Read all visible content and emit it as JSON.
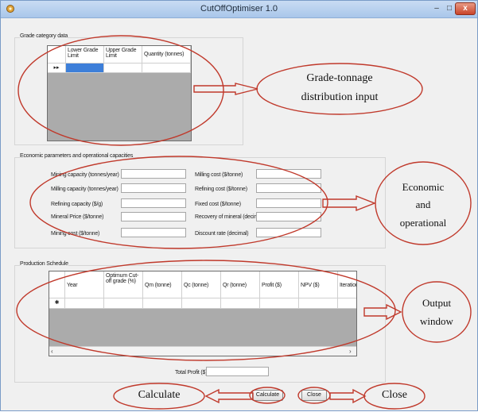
{
  "window": {
    "title": "CutOffOptimiser 1.0",
    "minimize": "–",
    "maximize": "□",
    "close": "x"
  },
  "grade_section": {
    "label": "Grade category data",
    "columns": [
      "Lower Grade Limit",
      "Upper Grade Limit",
      "Quantity (tonnes)"
    ],
    "row_marker": "▸▸"
  },
  "economic_section": {
    "label": "Economic parameters and operational capacities",
    "left_fields": [
      {
        "label": "Mining capacity (tonnes/year)",
        "value": ""
      },
      {
        "label": "Milling capacity (tonnes/year)",
        "value": ""
      },
      {
        "label": "Refining capacity ($/g)",
        "value": ""
      },
      {
        "label": "Mineral Price ($/tonne)",
        "value": ""
      },
      {
        "label": "Mining cost ($/tonne)",
        "value": ""
      }
    ],
    "right_fields": [
      {
        "label": "Milling cost ($/tonne)",
        "value": ""
      },
      {
        "label": "Refining cost ($/tonne)",
        "value": ""
      },
      {
        "label": "Fixed cost ($/tonne)",
        "value": ""
      },
      {
        "label": "Recovery of mineral (decimal)",
        "value": ""
      },
      {
        "label": "Discount rate (decimal)",
        "value": ""
      }
    ]
  },
  "production_section": {
    "label": "Production Schedule",
    "columns": [
      "Year",
      "Optimum Cut-off grade (%)",
      "Qm (tonne)",
      "Qc (tonne)",
      "Qr (tonne)",
      "Profit ($)",
      "NPV ($)",
      "Iterations"
    ],
    "row_marker": "✱",
    "total_profit_label": "Total Profit ($)",
    "total_profit_value": ""
  },
  "buttons": {
    "calculate": "Calculate",
    "close": "Close"
  },
  "annotations": {
    "grade_tonnage_line1": "Grade-tonnage",
    "grade_tonnage_line2": "distribution input",
    "economic_line1": "Economic",
    "economic_line2": "and",
    "economic_line3": "operational",
    "output_line1": "Output",
    "output_line2": "window",
    "calculate": "Calculate",
    "close": "Close"
  },
  "colors": {
    "annotation_red": "#c0392b",
    "selected_cell": "#3d7fd9",
    "grid_background": "#ababab",
    "close_button": "#c9442a"
  }
}
